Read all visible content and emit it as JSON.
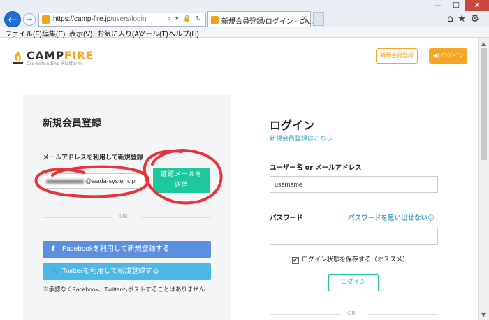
{
  "browser": {
    "back_icon": "arrow-left-icon",
    "forward_icon": "arrow-right-icon",
    "url_host": "https://camp-fire.jp",
    "url_path": "/users/login",
    "address_tools": "⌕ ▾ 🔒 ↻",
    "tab_title": "新規会員登録/ログイン - CA...",
    "tab_close": "×",
    "window_min": "—",
    "window_max": "☐",
    "window_close": "✕",
    "right_tools": "⌂★⚙"
  },
  "menubar": {
    "items": [
      {
        "label": "ファイル(F)"
      },
      {
        "label": "編集(E)"
      },
      {
        "label": "表示(V)"
      },
      {
        "label": "お気に入り(A)"
      },
      {
        "label": "ツール(T)"
      },
      {
        "label": "ヘルプ(H)"
      }
    ]
  },
  "header": {
    "logo_camp": "CAMP",
    "logo_fire": "FIRE",
    "logo_tagline": "Crowdfunding Platform",
    "signup_label": "新規会員登録",
    "login_label": "◀) ログイン",
    "brand_color": "#f5a623"
  },
  "signup": {
    "title": "新規会員登録",
    "email_section_label": "メールアドレスを利用して新規登録",
    "email_value_suffix": "@wada-system.jp",
    "send_line1": "確認メールを",
    "send_line2": "送信",
    "or_label": "OR",
    "facebook_icon": "f",
    "facebook_label": "Facebookを利用して新規登録する",
    "twitter_icon": "🐦",
    "twitter_label": "Twitterを利用して新規登録する",
    "note": "※承認なくFacebook、Twitterへポストすることはありません"
  },
  "login": {
    "title": "ログイン",
    "signup_link": "新規会員登録はこちら",
    "username_label": "ユーザー名 or メールアドレス",
    "username_value": "username",
    "password_label": "パスワード",
    "forgot_link": "パスワードを思い出せない😕",
    "remember_checkbox": "✔",
    "remember_label": "ログイン状態を保存する（オススメ）",
    "submit_label": "ログイン",
    "or_label": "OR"
  },
  "scrollbar": {
    "up": "▲",
    "down": "▼"
  }
}
